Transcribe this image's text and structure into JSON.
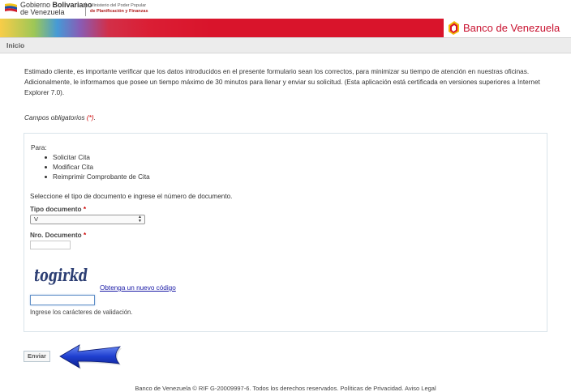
{
  "header": {
    "gob_line1_prefix": "Gobierno ",
    "gob_line1_bold": "Bolivariano",
    "gob_line2": "de Venezuela",
    "ministry_line1": "Ministerio del Poder Popular",
    "ministry_line2": "de Planificación y Finanzas",
    "bank_name": "Banco de Venezuela"
  },
  "breadcrumb": {
    "label": "Inicio"
  },
  "intro": {
    "text": "Estimado cliente, es importante verificar que los datos introducidos en el presente formulario sean los correctos, para minimizar su tiempo de atención en nuestras oficinas. Adicionalmente, le informamos que posee un tiempo máximo de 30 minutos para llenar y enviar su solicitud. (Esta aplicación está certificada en versiones superiores a Internet Explorer 7.0).",
    "required_note": "Campos obligatorios ",
    "required_mark": "(*)",
    "required_end": "."
  },
  "form": {
    "para_label": "Para:",
    "options": [
      "Solicitar Cita",
      "Modificar Cita",
      "Reimprimir Comprobante de Cita"
    ],
    "instruction": "Seleccione el tipo de documento e ingrese el número de documento.",
    "tipo_label": "Tipo documento ",
    "tipo_value": "V",
    "nro_label": "Nro. Documento ",
    "nro_value": "",
    "required_star": "*",
    "captcha_text": "togirkd",
    "captcha_link": "Obtenga un nuevo código",
    "captcha_value": "",
    "captcha_hint": "Ingrese los carácteres de validación.",
    "submit_label": "Enviar"
  },
  "footer": {
    "text": "Banco de Venezuela © RIF G-20009997-6. Todos los derechos reservados. Políticas de Privacidad. Aviso Legal"
  },
  "colors": {
    "brand_red": "#d9142b",
    "link_blue": "#1a1aa6",
    "arrow_blue": "#1f3fd0"
  },
  "icons": [
    "venezuela-flag-icon",
    "bcv-logo-icon",
    "select-arrows-icon",
    "pointer-arrow-icon"
  ]
}
